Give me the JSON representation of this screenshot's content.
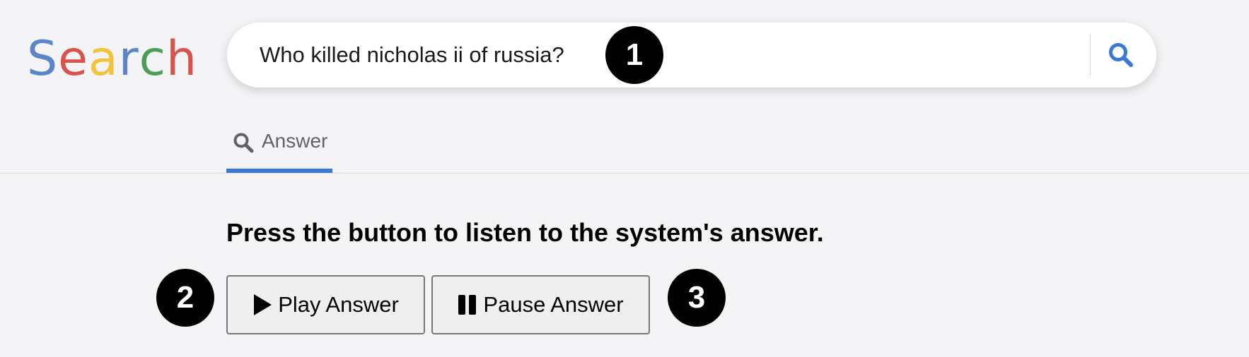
{
  "logo": {
    "letters": [
      "S",
      "e",
      "a",
      "r",
      "c",
      "h"
    ],
    "colors": [
      "#5b85c8",
      "#d9534a",
      "#f2c23a",
      "#5b85c8",
      "#4a9e57",
      "#d9534a"
    ]
  },
  "search": {
    "query": "Who killed nicholas ii of russia?",
    "button_icon": "search-icon",
    "accent": "#3a78d8"
  },
  "tabs": [
    {
      "label": "Answer",
      "icon": "search-icon",
      "active": true
    }
  ],
  "main": {
    "prompt": "Press the button to listen to the system's answer.",
    "play_label": "Play Answer",
    "play_icon": "play-icon",
    "pause_label": "Pause Answer",
    "pause_icon": "pause-icon"
  },
  "annotations": [
    "1",
    "2",
    "3"
  ]
}
